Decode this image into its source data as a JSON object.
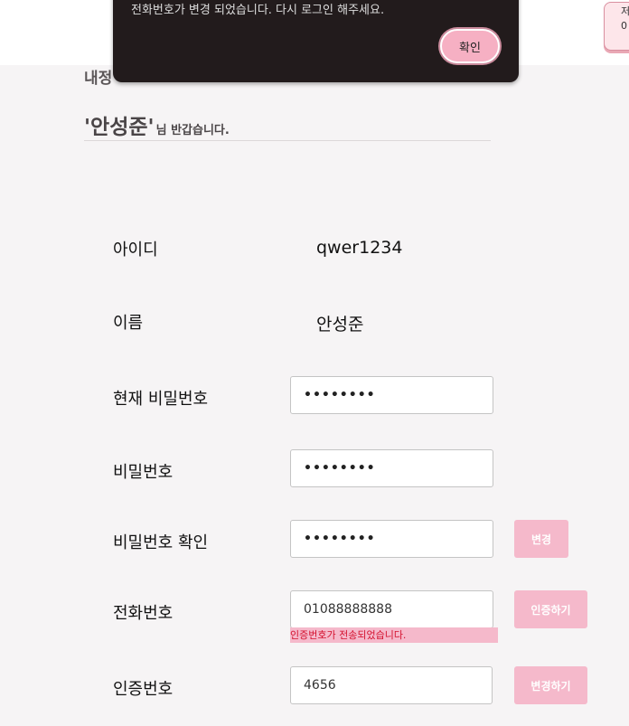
{
  "header": {
    "corner_button_line1": "저",
    "corner_button_line2": "0"
  },
  "page": {
    "section_title": "내정",
    "greeting_name": "'안성준'",
    "greeting_suffix": "님 반갑습니다."
  },
  "toast": {
    "message": "전화번호가 변경 되었습니다. 다시 로그인 해주세요.",
    "ok_label": "확인"
  },
  "form": {
    "id_label": "아이디",
    "id_value": "qwer1234",
    "name_label": "이름",
    "name_value": "안성준",
    "current_pw_label": "현재 비밀번호",
    "current_pw_mask": "••••••••",
    "pw_label": "비밀번호",
    "pw_mask": "••••••••",
    "pw_confirm_label": "비밀번호 확인",
    "pw_confirm_mask": "••••••••",
    "change_button": "변경",
    "phone_label": "전화번호",
    "phone_value": "01088888888",
    "verify_button": "인증하기",
    "verify_notice": "인증번호가 전송되었습니다.",
    "code_label": "인증번호",
    "code_value": "4656",
    "change_phone_button": "변경하기"
  },
  "colors": {
    "accent_pink": "#f5b9cb",
    "toast_bg": "#221b1c",
    "error_text": "#d4102e"
  }
}
